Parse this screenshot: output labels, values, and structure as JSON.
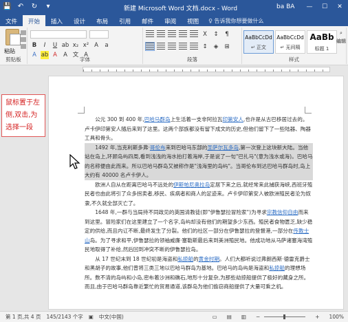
{
  "window": {
    "title": "新建 Microsoft Word 文档.docx - Word",
    "user": "ba BA",
    "min": "—",
    "max": "☐",
    "close": "✕"
  },
  "qat": {
    "save": "💾",
    "undo": "↶",
    "redo": "↻",
    "more": "▾"
  },
  "tabs": [
    "文件",
    "开始",
    "插入",
    "设计",
    "布局",
    "引用",
    "邮件",
    "审阅",
    "视图"
  ],
  "tell_me": "♀ 告诉我你想要做什么",
  "ribbon": {
    "clipboard": {
      "paste_label": "粘贴",
      "group_label": "剪贴板"
    },
    "font": {
      "group_label": "字体",
      "font_name": "",
      "font_size": ""
    },
    "paragraph": {
      "group_label": "段落"
    },
    "styles": {
      "group_label": "样式",
      "items": [
        {
          "sample": "AaBbCcDd",
          "name": "↵ 正文"
        },
        {
          "sample": "AaBbCcDd",
          "name": "↵ 无间隔"
        },
        {
          "sample": "AaBb",
          "name": "标题 1"
        }
      ]
    },
    "editing": {
      "label": "编辑"
    }
  },
  "callout": {
    "text": "鼠标置于左侧,双击,为选择一段"
  },
  "document": {
    "p1": "公元 300 到 400 年,",
    "p1_link1": "巴哈马群岛",
    "p1_b": "上生活着一支非阿拉瓦",
    "p1_link2": "印第安人",
    "p1_c": ",也许是从古巴移居过去的。卢卡伊印第安人随后来到了这里。这两个部族都没有留下成文的历史,但他们留下了一些陆器、陶器工具和骨头。",
    "p2": "1492 年,当克利斯多弗·",
    "p2_link1": "哥伦布",
    "p2_b": "来到巴哈马东部的",
    "p2_link2": "圣萨尔瓦多岛",
    "p2_c": ",第一次登上这块新大陆。当他站在岛上,环顾岛屿四周,看到浅浅的海水拍打着海岸,于是说了一句\"巴扎马\"(意为浅水或海)。巴哈马的名称便由此而来。所以巴哈马群岛又被称作是\"浅海里的岛屿\"。当哥伦布到达巴哈马群岛时,岛上大约有 40000 名卢卡伊人。",
    "p3": "欧洲人自从在距离巴哈马不远处的",
    "p3_link1": "伊斯帕尼奥拉岛",
    "p3_b": "定居下来之后,就经常来此捕获海峡,西班牙殖民者也由此将引了众多拐卖者,移民、疾病者和商人的足迹来。卢卡伊印第安人被欧洲殖民者沦为奴隶,不久就全部灭亡了。",
    "p4": "1648 年,一群与当局持不同政见的英国清教徒(即\"伊鲁瑟拉冒险家\")为寻求",
    "p4_link1": "宗教信仰自由",
    "p4_b": "而来到这里。冒险家们在这里建立了一个名字,岛屿却没有他们的期望多少东西。殖民者食物匮乏,缺少稳定的供给,而且内讧不断,最终发生了分裂。他们的社区一部分在伊鲁瑟拉的登督港,一部分在",
    "p4_link2": "传教士山",
    "p4_c": "岛。为了寻求和平,伊鲁瑟拉的领袖威廉·塞勒斯最后来到美洲殖民地。他成功地从马萨诸塞海湾殖民地取得了补给,然后回到冲突不断的伊鲁瑟拉岛。",
    "p5": "从 17 世纪末到 18 世纪初是海盗和",
    "p5_link1": "私掠船",
    "p5_b": "的",
    "p5_link2": "黄金时期",
    "p5_c": "。人们大都听说过弗朗西斯·德雷克爵士和黑胡子的故事,他们曾将三类三地以巴哈马群岛为基地。巴哈马的岛屿是海盗和",
    "p5_link3": "私掠船",
    "p5_d": "的理想场所。数不清的岛屿和小岛,密布着沙洲和礁石,地形十分复杂,为那些劫掠船提供了极好的藏身之所。而且,由于巴哈马群岛靠近繁忙的贸易通道,该群岛为他们偷窃商船提供了大量可乘之机。"
  },
  "status": {
    "page": "第 1 页,共 4 页",
    "words": "145/2143 个字",
    "lang": "中文(中国)",
    "zoom": "100%"
  }
}
